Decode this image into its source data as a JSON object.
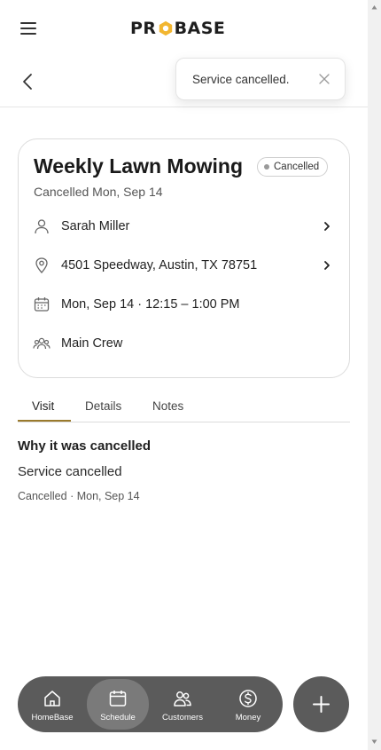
{
  "header": {
    "logo_text_left": "PR",
    "logo_text_right": "BASE",
    "brand_color": "#f2b630"
  },
  "toast": {
    "message": "Service cancelled."
  },
  "visit": {
    "title": "Weekly Lawn Mowing",
    "status_badge": "Cancelled",
    "subtitle": "Cancelled Mon, Sep 14",
    "customer": "Sarah Miller",
    "address": "4501 Speedway, Austin, TX 78751",
    "schedule": "Mon, Sep 14 · 12:15 – 1:00 PM",
    "crew": "Main Crew"
  },
  "tabs": [
    {
      "label": "Visit",
      "active": true
    },
    {
      "label": "Details",
      "active": false
    },
    {
      "label": "Notes",
      "active": false
    }
  ],
  "cancellation": {
    "heading": "Why it was cancelled",
    "reason": "Service cancelled",
    "meta": "Cancelled · Mon, Sep 14"
  },
  "bottom_nav": {
    "items": [
      {
        "label": "HomeBase",
        "icon": "home-icon",
        "active": false
      },
      {
        "label": "Schedule",
        "icon": "calendar-icon",
        "active": true
      },
      {
        "label": "Customers",
        "icon": "customers-icon",
        "active": false
      },
      {
        "label": "Money",
        "icon": "dollar-icon",
        "active": false
      }
    ],
    "fab_icon": "plus-icon"
  },
  "colors": {
    "tab_underline": "#9a7a2c",
    "nav_background": "#5b5b5b"
  }
}
